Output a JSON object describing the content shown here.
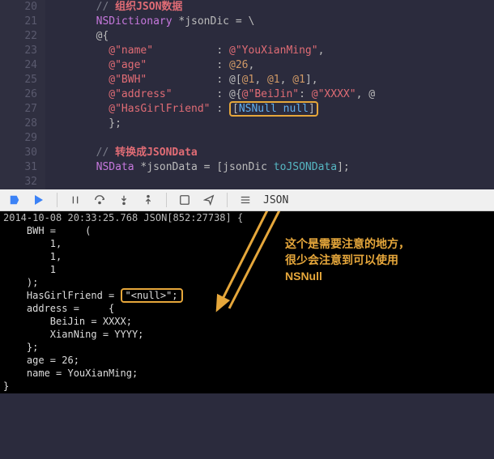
{
  "editor": {
    "lines": [
      {
        "n": 20,
        "tokens": [
          {
            "t": "        ",
            "c": ""
          },
          {
            "t": "// ",
            "c": "cm"
          },
          {
            "t": "组织JSON数据",
            "c": "cmZh"
          }
        ]
      },
      {
        "n": 21,
        "tokens": [
          {
            "t": "        ",
            "c": ""
          },
          {
            "t": "NSDictionary",
            "c": "ty"
          },
          {
            "t": " *jsonDic = \\",
            "c": "id"
          }
        ]
      },
      {
        "n": 22,
        "tokens": [
          {
            "t": "        ",
            "c": ""
          },
          {
            "t": "@{",
            "c": "pu"
          }
        ]
      },
      {
        "n": 23,
        "tokens": [
          {
            "t": "          ",
            "c": ""
          },
          {
            "t": "@\"name\"",
            "c": "str"
          },
          {
            "t": "          : ",
            "c": "pu"
          },
          {
            "t": "@\"YouXianMing\"",
            "c": "str"
          },
          {
            "t": ",",
            "c": "pu"
          }
        ]
      },
      {
        "n": 24,
        "tokens": [
          {
            "t": "          ",
            "c": ""
          },
          {
            "t": "@\"age\"",
            "c": "str"
          },
          {
            "t": "           : ",
            "c": "pu"
          },
          {
            "t": "@26",
            "c": "num"
          },
          {
            "t": ",",
            "c": "pu"
          }
        ]
      },
      {
        "n": 25,
        "tokens": [
          {
            "t": "          ",
            "c": ""
          },
          {
            "t": "@\"BWH\"",
            "c": "str"
          },
          {
            "t": "           : ",
            "c": "pu"
          },
          {
            "t": "@[",
            "c": "pu"
          },
          {
            "t": "@1",
            "c": "num"
          },
          {
            "t": ", ",
            "c": "pu"
          },
          {
            "t": "@1",
            "c": "num"
          },
          {
            "t": ", ",
            "c": "pu"
          },
          {
            "t": "@1",
            "c": "num"
          },
          {
            "t": "],",
            "c": "pu"
          }
        ]
      },
      {
        "n": 26,
        "tokens": [
          {
            "t": "          ",
            "c": ""
          },
          {
            "t": "@\"address\"",
            "c": "str"
          },
          {
            "t": "       : ",
            "c": "pu"
          },
          {
            "t": "@{",
            "c": "pu"
          },
          {
            "t": "@\"BeiJin\"",
            "c": "str"
          },
          {
            "t": ": ",
            "c": "pu"
          },
          {
            "t": "@\"XXXX\"",
            "c": "str"
          },
          {
            "t": ", ",
            "c": "pu"
          },
          {
            "t": "@",
            "c": "pu"
          }
        ]
      },
      {
        "n": 27,
        "tokens": [
          {
            "t": "          ",
            "c": ""
          },
          {
            "t": "@\"HasGirlFriend\"",
            "c": "str"
          },
          {
            "t": " : ",
            "c": "pu"
          },
          {
            "hl": true,
            "inner": [
              {
                "t": "[",
                "c": "pu"
              },
              {
                "t": "NSNull",
                "c": "nsn"
              },
              {
                "t": " ",
                "c": ""
              },
              {
                "t": "null",
                "c": "nsn"
              },
              {
                "t": "]",
                "c": "pu"
              }
            ]
          }
        ]
      },
      {
        "n": 28,
        "tokens": [
          {
            "t": "          ",
            "c": ""
          },
          {
            "t": "};",
            "c": "pu"
          }
        ]
      },
      {
        "n": 29,
        "tokens": []
      },
      {
        "n": 30,
        "tokens": [
          {
            "t": "        ",
            "c": ""
          },
          {
            "t": "// ",
            "c": "cm"
          },
          {
            "t": "转换成JSONData",
            "c": "cmZh"
          }
        ]
      },
      {
        "n": 31,
        "tokens": [
          {
            "t": "        ",
            "c": ""
          },
          {
            "t": "NSData",
            "c": "ty"
          },
          {
            "t": " *jsonData = [",
            "c": "id"
          },
          {
            "t": "jsonDic",
            "c": "id"
          },
          {
            "t": " ",
            "c": ""
          },
          {
            "t": "toJSONData",
            "c": "fn"
          },
          {
            "t": "];",
            "c": "pu"
          }
        ]
      },
      {
        "n": 32,
        "tokens": []
      }
    ]
  },
  "toolbar": {
    "label": "JSON"
  },
  "console": {
    "timestamp": "2014-10-08 20:33:25.768 JSON[852:27738] {",
    "lines": [
      "    BWH =     (",
      "        1,",
      "        1,",
      "        1",
      "    );",
      "    HasGirlFriend = ",
      "    address =     {",
      "        BeiJin = XXXX;",
      "        XianNing = YYYY;",
      "    };",
      "    age = 26;",
      "    name = YouXianMing;",
      "}"
    ],
    "null_literal": "\"<null>\";"
  },
  "annotation": {
    "l1": "这个是需要注意的地方，",
    "l2": "很少会注意到可以使用",
    "l3": "NSNull"
  }
}
